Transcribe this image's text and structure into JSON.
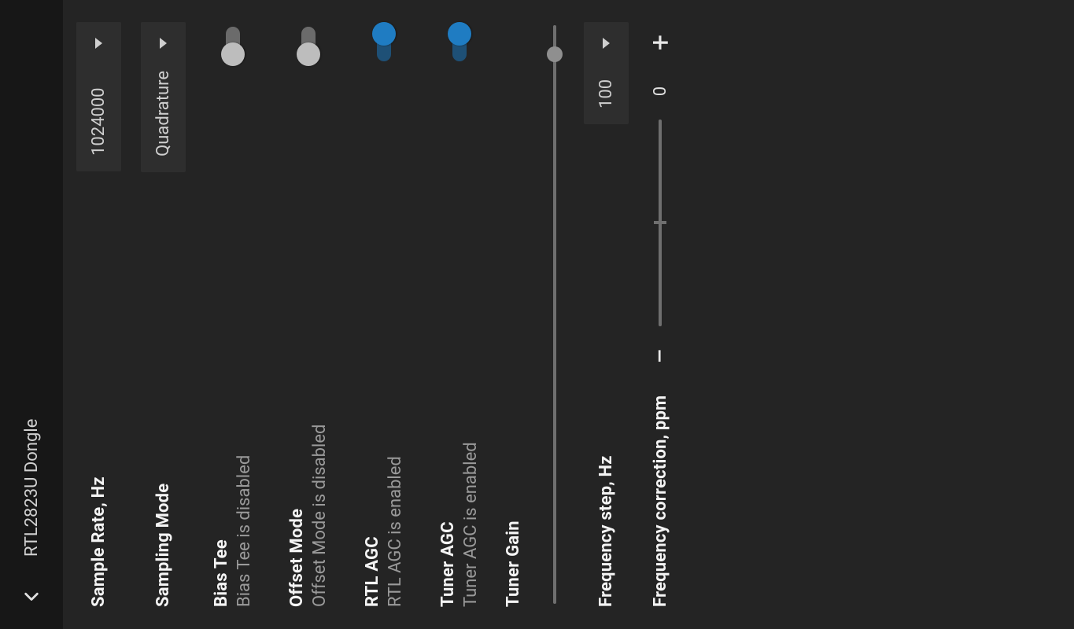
{
  "appbar": {
    "title": "RTL2823U Dongle"
  },
  "sample_rate": {
    "label": "Sample Rate, Hz",
    "value": "1024000"
  },
  "sampling_mode": {
    "label": "Sampling Mode",
    "value": "Quadrature"
  },
  "bias_tee": {
    "label": "Bias Tee",
    "status": "Bias Tee is disabled",
    "on": false
  },
  "offset_mode": {
    "label": "Offset Mode",
    "status": "Offset Mode is disabled",
    "on": false
  },
  "rtl_agc": {
    "label": "RTL AGC",
    "status": "RTL AGC is enabled",
    "on": true
  },
  "tuner_agc": {
    "label": "Tuner AGC",
    "status": "Tuner AGC is enabled",
    "on": true
  },
  "tuner_gain": {
    "label": "Tuner Gain",
    "value_pct": 95
  },
  "freq_step": {
    "label": "Frequency step, Hz",
    "value": "100"
  },
  "freq_corr": {
    "label": "Frequency correction, ppm",
    "value": "0",
    "minus": "−",
    "plus": "+"
  }
}
